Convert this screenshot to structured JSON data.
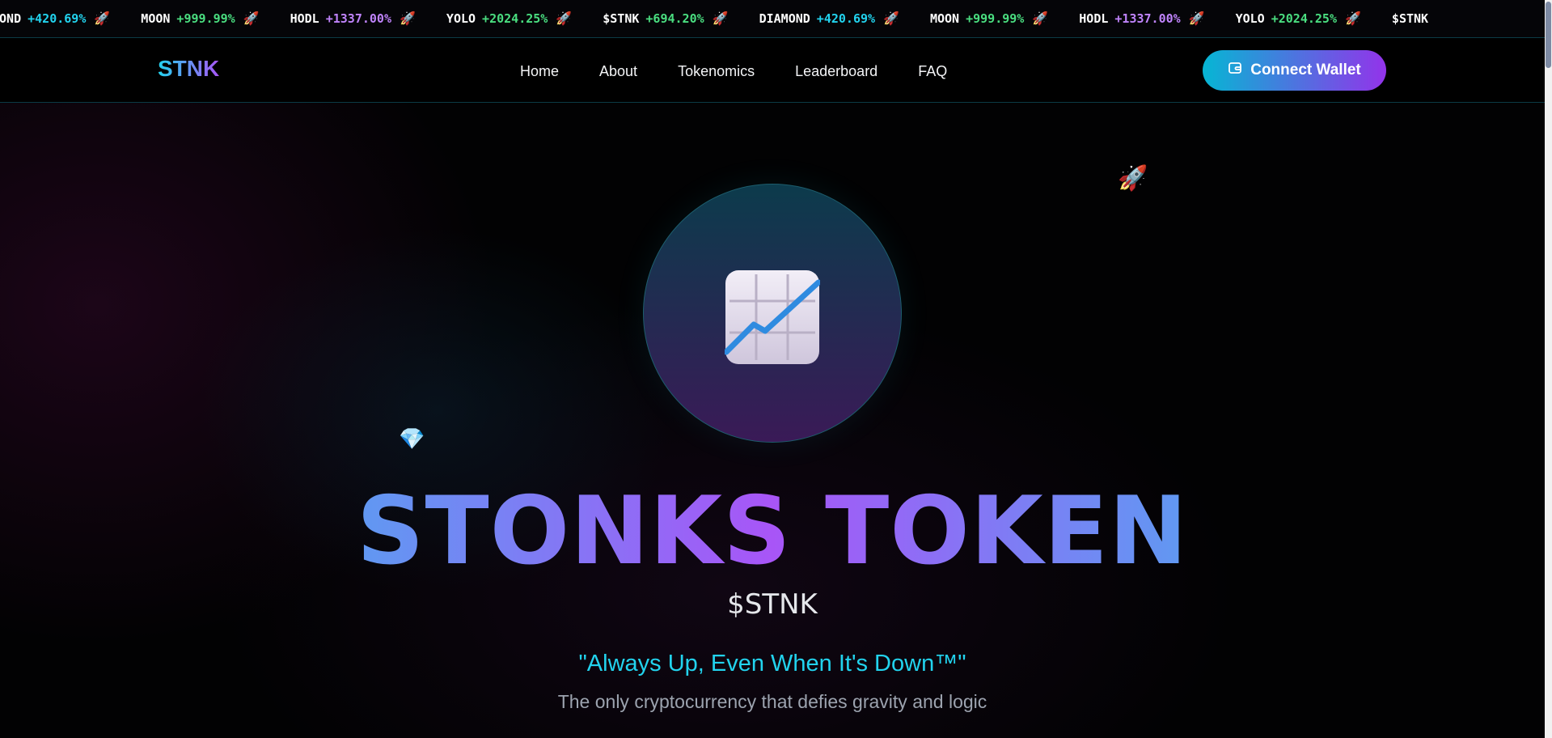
{
  "ticker": [
    {
      "symbol": "MOND",
      "change": "+420.69%",
      "tone": "cyan",
      "icon": "🚀"
    },
    {
      "symbol": "MOON",
      "change": "+999.99%",
      "tone": "green",
      "icon": "🚀"
    },
    {
      "symbol": "HODL",
      "change": "+1337.00%",
      "tone": "purple",
      "icon": "🚀"
    },
    {
      "symbol": "YOLO",
      "change": "+2024.25%",
      "tone": "green",
      "icon": "🚀"
    },
    {
      "symbol": "$STNK",
      "change": "+694.20%",
      "tone": "green",
      "icon": "🚀"
    },
    {
      "symbol": "DIAMOND",
      "change": "+420.69%",
      "tone": "cyan",
      "icon": "🚀"
    },
    {
      "symbol": "MOON",
      "change": "+999.99%",
      "tone": "green",
      "icon": "🚀"
    },
    {
      "symbol": "HODL",
      "change": "+1337.00%",
      "tone": "purple",
      "icon": "🚀"
    },
    {
      "symbol": "YOLO",
      "change": "+2024.25%",
      "tone": "green",
      "icon": "🚀"
    },
    {
      "symbol": "$STNK",
      "change": "",
      "tone": "green",
      "icon": ""
    }
  ],
  "nav": {
    "logo": "STNK",
    "links": [
      "Home",
      "About",
      "Tokenomics",
      "Leaderboard",
      "FAQ"
    ],
    "connect_label": "Connect Wallet",
    "connect_icon": "wallet-icon"
  },
  "hero": {
    "title": "STONKS TOKEN",
    "symbol": "$STNK",
    "tagline": "\"Always Up, Even When It's Down™\"",
    "subtitle": "The only cryptocurrency that defies gravity and logic",
    "decorations": {
      "rocket": "🚀",
      "diamond": "💎"
    },
    "center_icon": "chart-increasing-icon"
  },
  "colors": {
    "accent_cyan": "#22d3ee",
    "accent_purple": "#a855f7",
    "positive_green": "#4ade80",
    "background": "#000000"
  }
}
